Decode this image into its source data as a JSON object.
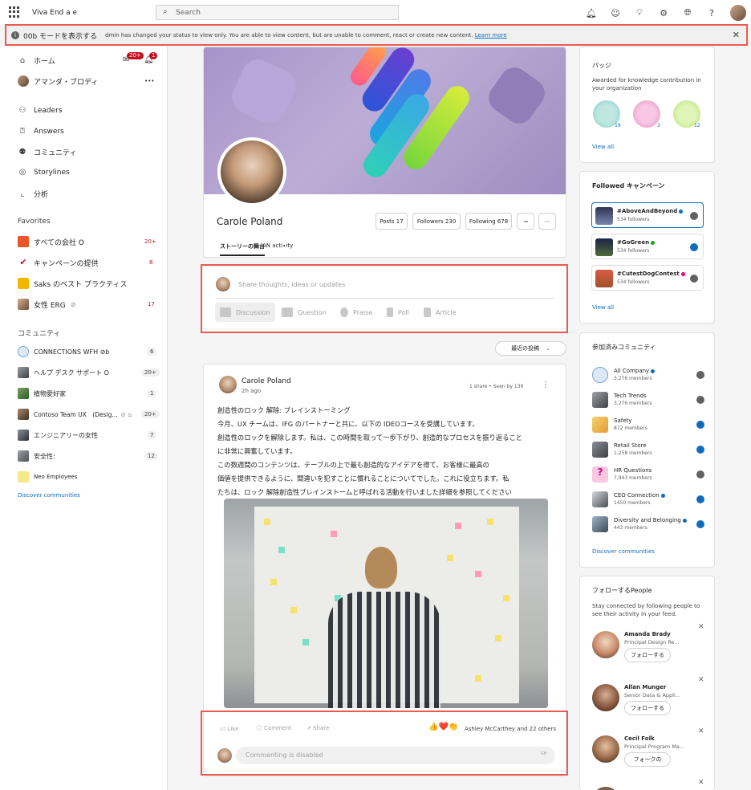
{
  "app": {
    "name": "Viva End a e"
  },
  "search": {
    "placeholder": "Search"
  },
  "banner": {
    "title": "00b モードを表示する",
    "message": "dmin has changed your status to view only. You are able to view content, but are unable to comment, react or create new content.",
    "link": "Learn more"
  },
  "nav": {
    "home": "ホーム",
    "inbox_badge": "20+",
    "bell_badge": "1",
    "user": "アマンダ・ブロディ",
    "more": "•••",
    "items": [
      "Leaders",
      "Answers",
      "コミュニティ",
      "Storylines",
      "分析"
    ],
    "favorites_title": "Favorites",
    "favorites": [
      {
        "label": "すべての会社 O",
        "count": "20+"
      },
      {
        "label": "キャンペーンの提供",
        "count": "8"
      },
      {
        "label": "Saks のベスト プラクティス",
        "count": ""
      },
      {
        "label": "女性 ERG",
        "count": "17"
      }
    ],
    "communities_title": "コミュニティ",
    "communities": [
      {
        "label": "CONNECTIONS WFH ⊘b",
        "count": "6"
      },
      {
        "label": "ヘルプ デスク サポート O",
        "count": "20+"
      },
      {
        "label": "植物愛好家",
        "count": "1"
      },
      {
        "label": "Contoso Team UX　(Desig...",
        "count": "20+"
      },
      {
        "label": "エンジニアリーの女性",
        "count": "7"
      },
      {
        "label": "安全性:",
        "count": "12"
      },
      {
        "label": "Neo Employees",
        "count": ""
      }
    ],
    "discover": "Discover communities"
  },
  "profile": {
    "name": "Carole Poland",
    "posts": "Posts 17",
    "followers": "Followers 230",
    "following": "Following 678",
    "tab_story": "ストーリーの舞台",
    "tab_activity": "AN acti∙ity"
  },
  "composer": {
    "placeholder": "Share thoughts, ideas or updates",
    "buttons": [
      "Discussion",
      "Question",
      "Praise",
      "Poll",
      "Article"
    ]
  },
  "sort": {
    "label": "最近の投稿"
  },
  "post": {
    "author": "Carole Poland",
    "time": "2h ago",
    "meta": "1 share  •  Seen by 139",
    "title": "創造性のロック 解除: ブレインストーミング",
    "lines": [
      "今月、UX チームは、IFG のパートナーと共に、以下の IDEOコースを受講しています。",
      "創造性のロックを解除します。私は、この時間を取って一歩下がり、創造的なプロセスを振り返ること",
      "に非常に興奮しています。",
      "この数週間のコンテンツは、テーブルの上で最も創造的なアイデアを得て、お客様に最高の",
      "価値を提供できるように、間違いを犯すことに慣れることについてでした。これに役立ちます。私",
      "たちは、ロック 解除創造性ブレインストームと呼ばれる活動を行いました詳細を参照してください"
    ],
    "like": "Like",
    "comment": "Comment",
    "share": "Share",
    "reactions": "👍❤️👏",
    "reacted_by": "Ashley McCarthey and 22 others",
    "comment_placeholder": "Commenting is disabled",
    "gif": "GIF"
  },
  "badges": {
    "title": "バッジ",
    "subtitle": "Awarded for knowledge contribution in your organization",
    "counts": [
      "19",
      "3",
      "12"
    ],
    "view_all": "View all"
  },
  "campaigns": {
    "title": "Followed キャンペーン",
    "items": [
      {
        "name": "#AboveAndBeyond",
        "followers": "534 followers"
      },
      {
        "name": "#GoGreen",
        "followers": "534 followers"
      },
      {
        "name": "#CutestDogContest",
        "followers": "534 followers"
      }
    ],
    "view_all": "View all"
  },
  "joined": {
    "title": "参加済みコミュニティ",
    "items": [
      {
        "name": "All Company",
        "members": "3,276 members"
      },
      {
        "name": "Tech Trends",
        "members": "3,276 members"
      },
      {
        "name": "Safety",
        "members": "872 members"
      },
      {
        "name": "Retail Store",
        "members": "1,258 members"
      },
      {
        "name": "HR Questions",
        "members": "7,943 members"
      },
      {
        "name": "CEO Connection",
        "members": "1450 members"
      },
      {
        "name": "Diversity and Belonging",
        "members": "443 members"
      }
    ],
    "discover": "Discover communities"
  },
  "people": {
    "title": "フォローするPeople",
    "subtitle": "Stay connected by following people to see their activity in your feed.",
    "items": [
      {
        "name": "Amanda Brady",
        "role": "Principal Design Re...",
        "button": "フォローする"
      },
      {
        "name": "Allan Munger",
        "role": "Senior Data & Appli...",
        "button": "フォローする"
      },
      {
        "name": "Cecil Folk",
        "role": "Principal Program Ma...",
        "button": "フォークの"
      }
    ]
  },
  "colors": {
    "accent": "#0f6cbd",
    "highlight": "#ec5a50",
    "alert": "#c50f1f"
  }
}
